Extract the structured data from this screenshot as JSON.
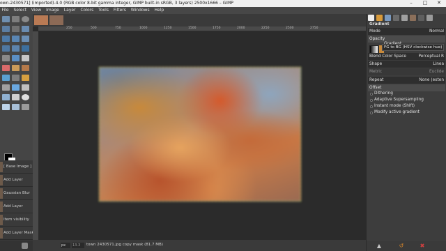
{
  "window": {
    "title": "own-2430571] (imported)-4.0 (RGB color 8-bit gamma integer, GIMP built-in sRGB, 3 layers) 2500x1666 – GIMP",
    "minimize": "–",
    "maximize": "□",
    "close": "✕"
  },
  "menu": [
    "File",
    "Select",
    "View",
    "Image",
    "Layer",
    "Colors",
    "Tools",
    "Filters",
    "Windows",
    "Help"
  ],
  "ruler": [
    "250",
    "500",
    "750",
    "1000",
    "1250",
    "1500",
    "1750",
    "2000",
    "2250",
    "2500",
    "2750"
  ],
  "history": [
    {
      "label": "[ Base Image ]"
    },
    {
      "label": "Add Layer"
    },
    {
      "label": "Gaussian Blur"
    },
    {
      "label": "Add Layer"
    },
    {
      "label": "Item visibility"
    },
    {
      "label": "Add Layer Mask"
    }
  ],
  "status": {
    "unit": "px",
    "zoom": "13.3",
    "message": "town 2430571.jpg copy mask (81.7 MB)"
  },
  "dock": {
    "title": "Gradient",
    "mode_label": "Mode",
    "mode_value": "Normal",
    "opacity_label": "Opacity",
    "gradient_label": "Gradient",
    "gradient_tooltip": "FG to BG (HSV clockwise hue)",
    "blend_space_label": "Blend Color Space",
    "blend_space_value": "Perceptual R",
    "shape_label": "Shape",
    "shape_value": "Linea",
    "metric_label": "Metric",
    "metric_value": "Euclide",
    "repeat_label": "Repeat",
    "repeat_value": "None (exten",
    "offset_label": "Offset",
    "options": [
      "Dithering",
      "Adaptive Supersampling",
      "Instant mode (Shift)",
      "Modify active gradient"
    ]
  },
  "colors": {
    "accent": "#c8d870",
    "selection": "#3d7ac4"
  }
}
